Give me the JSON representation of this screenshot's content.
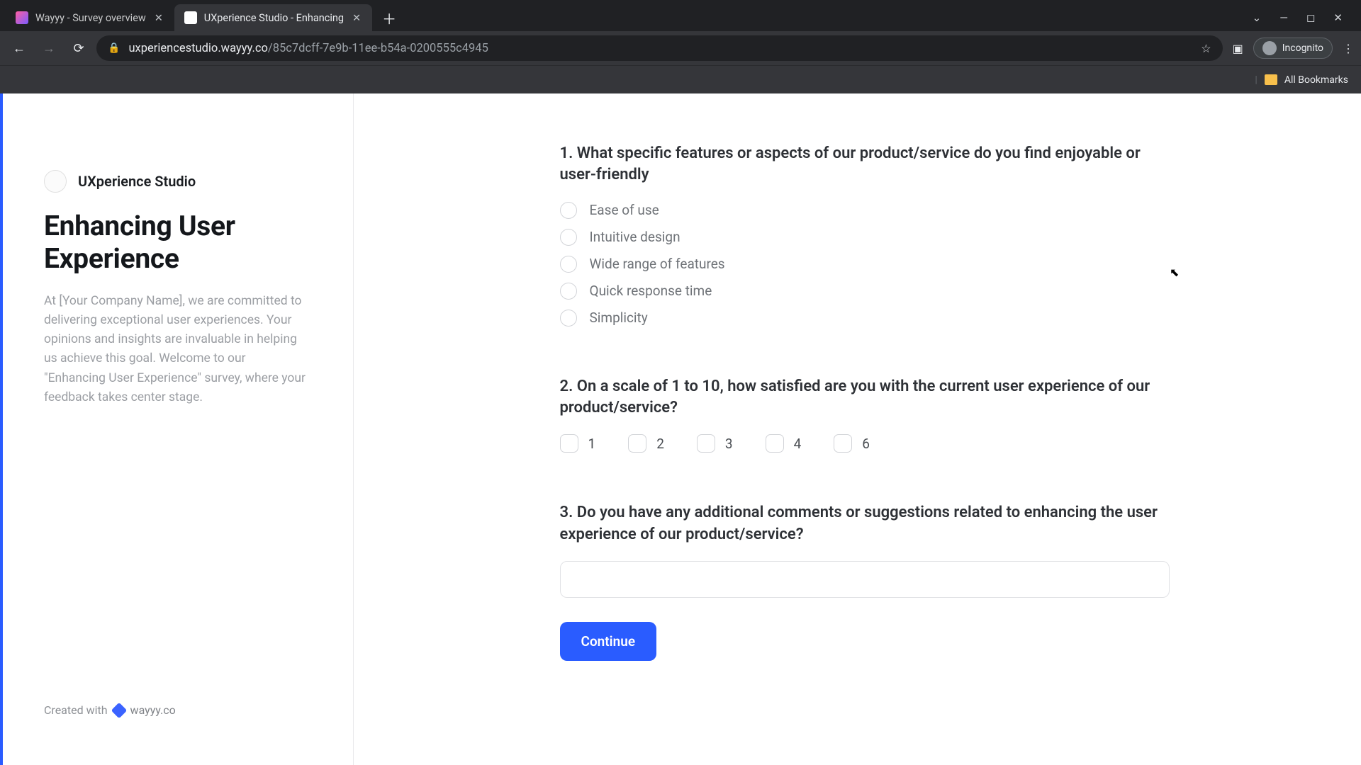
{
  "browser": {
    "tabs": [
      {
        "title": "Wayyy - Survey overview",
        "active": false
      },
      {
        "title": "UXperience Studio - Enhancing",
        "active": true
      }
    ],
    "url_host": "uxperiencestudio.wayyy.co",
    "url_path": "/85c7dcff-7e9b-11ee-b54a-0200555c4945",
    "incognito_label": "Incognito",
    "all_bookmarks": "All Bookmarks"
  },
  "sidebar": {
    "brand": "UXperience Studio",
    "title": "Enhancing User Experience",
    "description": "At [Your Company Name], we are committed to delivering exceptional user experiences. Your opinions and insights are invaluable in helping us achieve this goal. Welcome to our \"Enhancing User Experience\" survey, where your feedback takes center stage.",
    "created_with": "Created with",
    "wayyy": "wayyy.co"
  },
  "questions": {
    "q1": {
      "text": "1. What specific features or aspects of our product/service do you find enjoyable or user-friendly",
      "options": [
        "Ease of use",
        "Intuitive design",
        "Wide range of features",
        "Quick response time",
        "Simplicity"
      ]
    },
    "q2": {
      "text": "2. On a scale of 1 to 10, how satisfied are you with the current user experience of our product/service?",
      "options": [
        "1",
        "2",
        "3",
        "4",
        "6"
      ]
    },
    "q3": {
      "text": "3. Do you have any additional comments or suggestions related to enhancing the user experience of our product/service?",
      "placeholder": ""
    }
  },
  "actions": {
    "continue": "Continue"
  }
}
